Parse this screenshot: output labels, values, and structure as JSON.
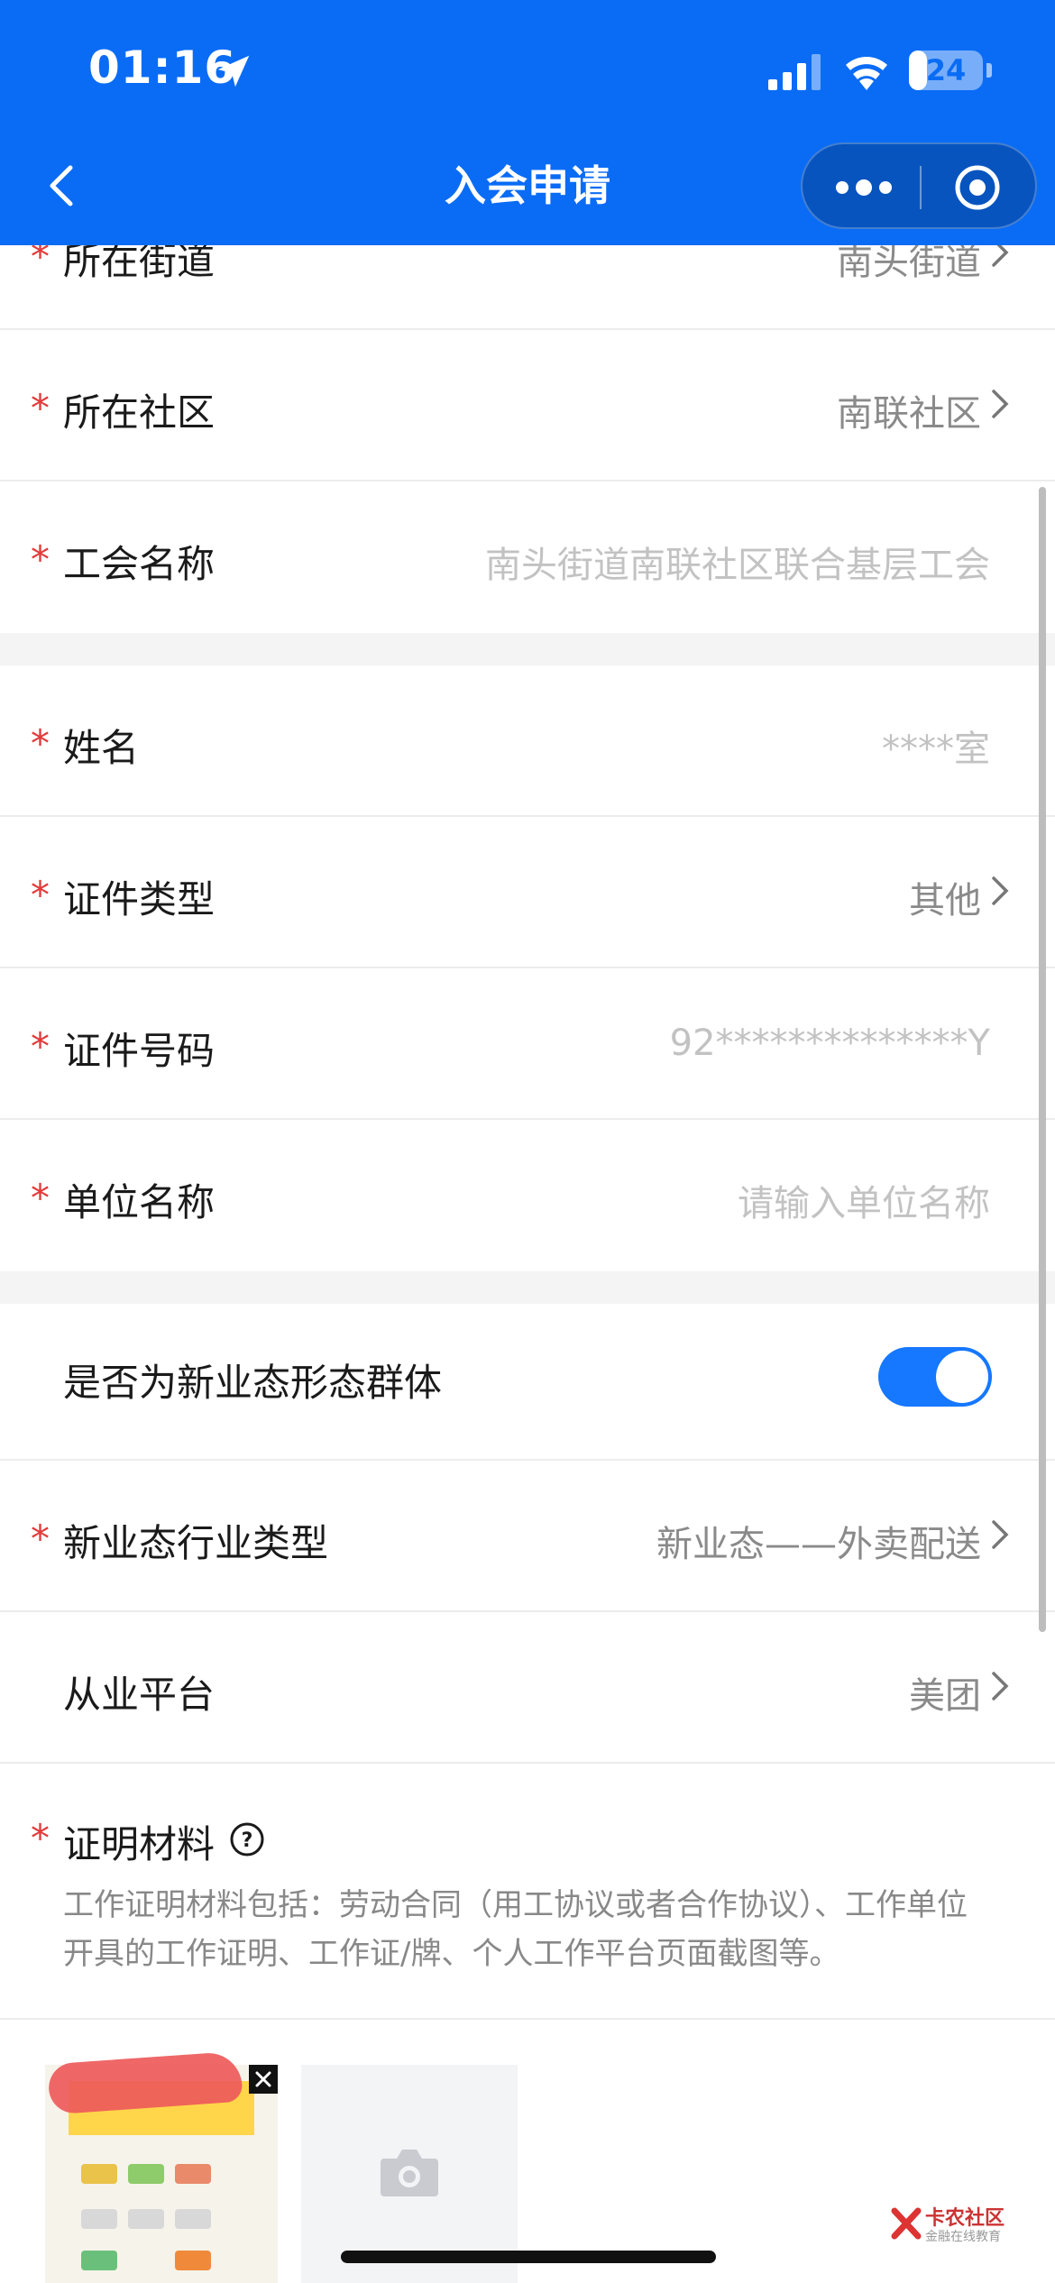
{
  "status_bar": {
    "time": "01:16",
    "battery": "24",
    "battery_level": 0.24
  },
  "nav": {
    "title": "入会申请"
  },
  "form": {
    "street": {
      "label": "所在街道",
      "value": "南头街道"
    },
    "community": {
      "label": "所在社区",
      "value": "南联社区"
    },
    "union": {
      "label": "工会名称",
      "value": "南头街道南联社区联合基层工会"
    },
    "name": {
      "label": "姓名",
      "value": "****室"
    },
    "id_type": {
      "label": "证件类型",
      "value": "其他"
    },
    "id_number": {
      "label": "证件号码",
      "value": "92**************Y"
    },
    "employer": {
      "label": "单位名称",
      "placeholder": "请输入单位名称"
    },
    "new_business": {
      "label": "是否为新业态形态群体",
      "enabled": true
    },
    "industry_type": {
      "label": "新业态行业类型",
      "value": "新业态——外卖配送"
    },
    "platform": {
      "label": "从业平台",
      "value": "美团"
    },
    "proof": {
      "label": "证明材料",
      "description": "工作证明材料包括：劳动合同（用工协议或者合作协议）、工作单位开具的工作证明、工作证/牌、个人工作平台页面截图等。"
    },
    "required_mark": "*"
  },
  "watermark": {
    "title": "卡农社区",
    "subtitle": "金融在线教育"
  },
  "colors": {
    "header": "#0a6cf5",
    "toggle": "#1677ff",
    "required": "#e23a3a"
  }
}
